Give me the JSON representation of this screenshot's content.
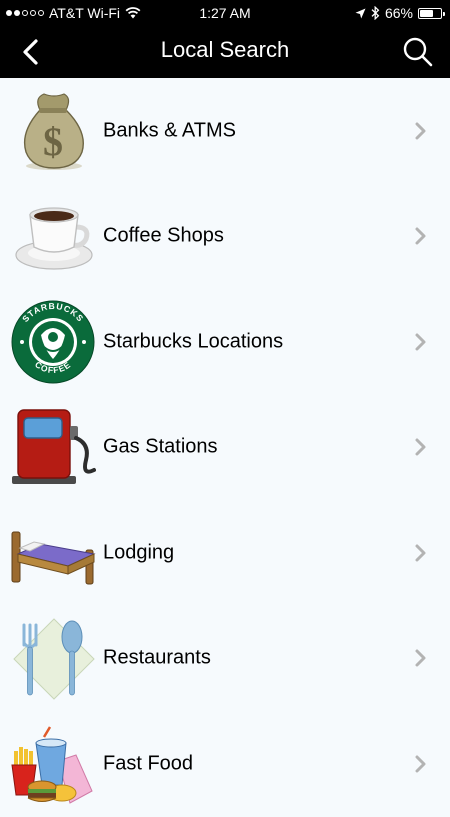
{
  "status_bar": {
    "carrier": "AT&T Wi-Fi",
    "time": "1:27 AM",
    "battery": "66%",
    "battery_level": 0.66,
    "signal_bars_filled": 2,
    "signal_bars_total": 5
  },
  "nav": {
    "title": "Local Search",
    "back_icon": "chevron-left-icon",
    "search_icon": "search-icon"
  },
  "items": [
    {
      "label": "Banks & ATMS",
      "icon": "money-bag-icon"
    },
    {
      "label": "Coffee Shops",
      "icon": "coffee-cup-icon"
    },
    {
      "label": "Starbucks Locations",
      "icon": "starbucks-logo-icon",
      "logo_text": "STARBUCKS COFFEE"
    },
    {
      "label": "Gas Stations",
      "icon": "gas-pump-icon"
    },
    {
      "label": "Lodging",
      "icon": "bed-icon"
    },
    {
      "label": "Restaurants",
      "icon": "fork-spoon-icon"
    },
    {
      "label": "Fast Food",
      "icon": "fast-food-icon"
    }
  ],
  "colors": {
    "header": "#000000",
    "background": "#f6fafd",
    "chevron": "#b3b3b3"
  }
}
